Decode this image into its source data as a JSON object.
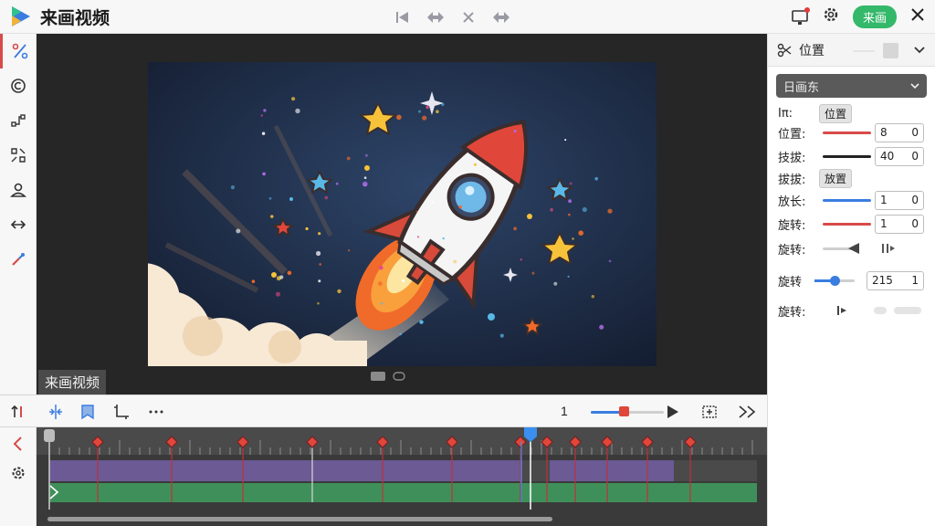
{
  "app": {
    "title": "来画视频"
  },
  "top_actions": {
    "export_label": "来画"
  },
  "preview": {
    "clip_label": "来画视频"
  },
  "properties": {
    "header_title": "位置",
    "dropdown_value": "日画东",
    "tag_row_prefix": "Iπ:",
    "tag_row_value": "位置",
    "rows": [
      {
        "label": "位置:",
        "value_a": "8",
        "value_b": "0"
      },
      {
        "label": "技拔:",
        "value_a": "40",
        "value_b": "0"
      },
      {
        "label": "放长:",
        "value_a": "1",
        "value_b": "0"
      },
      {
        "label": "旋转:",
        "value_a": "1",
        "value_b": "0"
      }
    ],
    "tag_row2_label": "拔拔:",
    "tag_row2_value": "放置",
    "rotate_label_1": "旋转:",
    "rotate_label_2": "旋转",
    "rotate_value_a": "215",
    "rotate_value_b": "1",
    "rotate_label_3": "旋转:"
  },
  "timeline": {
    "zoom_label": "1",
    "zoom_level": 0.45,
    "playhead_time_fraction": 0.68
  },
  "colors": {
    "accent_red": "#d94a4a",
    "accent_green": "#34b86a",
    "track_purple": "#6b5a94",
    "track_green": "#3f8f5a"
  },
  "icons": {
    "left_rail": [
      "percent-icon",
      "copyright-icon",
      "connect-icon",
      "transform-icon",
      "person-icon",
      "arrows-icon",
      "color-pick-icon"
    ],
    "top_center": [
      "skip-start-icon",
      "swap-icon",
      "cross-icon",
      "swap-right-icon"
    ],
    "top_right": [
      "monitor-icon",
      "settings-icon",
      "close-icon"
    ]
  }
}
